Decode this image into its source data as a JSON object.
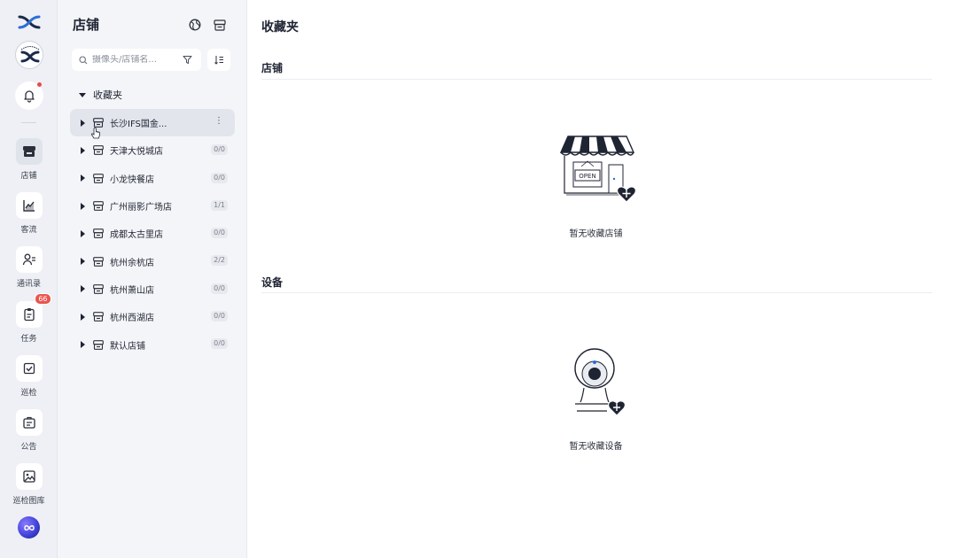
{
  "rail": {
    "items": [
      {
        "label": "店铺",
        "icon": "store-icon",
        "active": true
      },
      {
        "label": "客流",
        "icon": "chart-icon"
      },
      {
        "label": "通讯录",
        "icon": "contacts-icon"
      },
      {
        "label": "任务",
        "icon": "task-icon",
        "badge": "66"
      },
      {
        "label": "巡检",
        "icon": "checklist-icon"
      },
      {
        "label": "公告",
        "icon": "announcement-icon"
      },
      {
        "label": "巡检图库",
        "icon": "gallery-icon"
      }
    ]
  },
  "panel": {
    "title": "店铺",
    "search_placeholder": "摄像头/店铺名...",
    "favorites_label": "收藏夹",
    "stores": [
      {
        "name": "长沙IFS国金...",
        "count": "",
        "active": true
      },
      {
        "name": "天津大悦城店",
        "count": "0/0"
      },
      {
        "name": "小龙快餐店",
        "count": "0/0"
      },
      {
        "name": "广州丽影广场店",
        "count": "1/1"
      },
      {
        "name": "成都太古里店",
        "count": "0/0"
      },
      {
        "name": "杭州余杭店",
        "count": "2/2"
      },
      {
        "name": "杭州萧山店",
        "count": "0/0"
      },
      {
        "name": "杭州西湖店",
        "count": "0/0"
      },
      {
        "name": "默认店铺",
        "count": "0/0"
      }
    ]
  },
  "main": {
    "title": "收藏夹",
    "stores_section": "店铺",
    "stores_empty": "暂无收藏店铺",
    "devices_section": "设备",
    "devices_empty": "暂无收藏设备",
    "sign_text": "OPEN"
  },
  "colors": {
    "rail_bg": "#eef0f5",
    "panel_bg": "#f4f5f8",
    "active_row": "#e2e5ec",
    "badge": "#e8564f",
    "ink": "#1f2433"
  }
}
